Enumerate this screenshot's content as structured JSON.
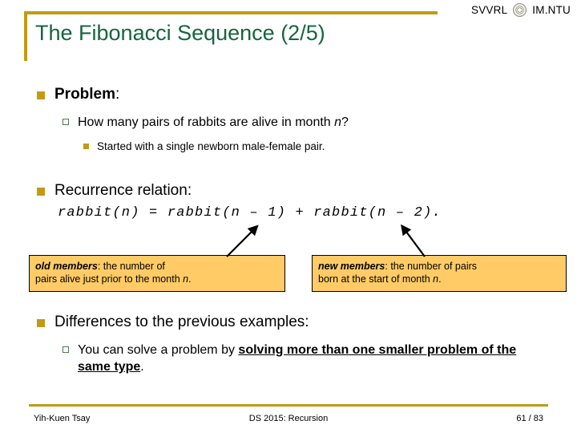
{
  "header": {
    "title": "The Fibonacci Sequence (2/5)",
    "brand_left": "SVVRL",
    "brand_right": "IM.NTU",
    "seal_icon": "ntu-seal-icon",
    "rule_color": "#bf9b17",
    "title_color": "#16653f"
  },
  "content": {
    "problem_label": "Problem",
    "problem_colon": ":",
    "question_prefix": "How many pairs of rabbits are alive in month ",
    "question_var": "n",
    "question_suffix": "?",
    "started_note": "Started with a single newborn male-female pair.",
    "recurrence_label": "Recurrence relation",
    "recurrence_colon": ":",
    "formula": "rabbit(n) = rabbit(n – 1) + rabbit(n – 2).",
    "differences_label": "Differences to the previous examples:",
    "solve_prefix": "You can solve a problem by ",
    "solve_emphasis": "solving more than one smaller problem of the same type",
    "solve_suffix": "."
  },
  "callouts": {
    "old": {
      "term": "old members",
      "separator": ": ",
      "line1": "the number of",
      "line2_prefix": "pairs alive just prior to the month ",
      "line2_var": "n",
      "line2_suffix": ".",
      "fill_color": "#ffcb66",
      "border_color": "#000000"
    },
    "new": {
      "term": "new members",
      "separator": ": ",
      "line1": "the number of pairs",
      "line2_prefix": "born at the start of month ",
      "line2_var": "n",
      "line2_suffix": ".",
      "fill_color": "#ffcb66",
      "border_color": "#000000"
    }
  },
  "arrows": {
    "left_arrow": "arrow-old-to-term1",
    "right_arrow": "arrow-new-to-term2"
  },
  "footer": {
    "author": "Yih-Kuen Tsay",
    "course": "DS 2015: Recursion",
    "page": "61 / 83",
    "rule_color": "#bf9b17"
  }
}
